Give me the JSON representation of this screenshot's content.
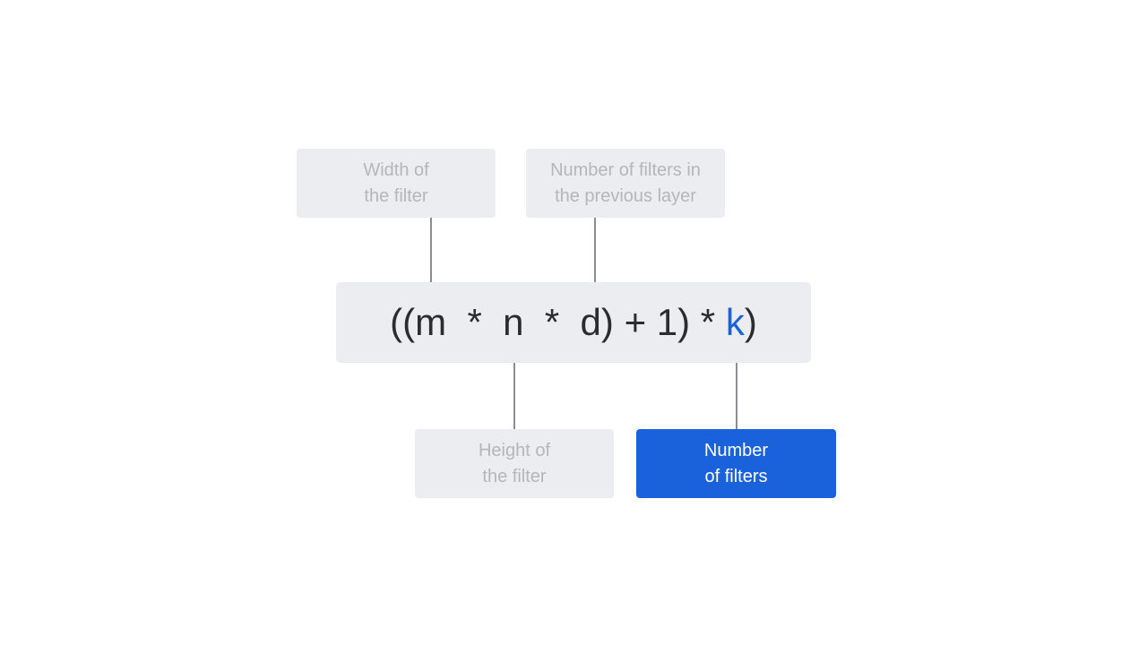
{
  "formula": {
    "parts": [
      "((m",
      "  *  ",
      "n",
      "  *  ",
      "d)",
      " + ",
      "1)",
      " * ",
      "k",
      ")"
    ],
    "highlight_color": "#1a62dc"
  },
  "labels": {
    "width": [
      "Width of",
      "the filter"
    ],
    "prev_filters": [
      "Number of filters in",
      "the previous layer"
    ],
    "height": [
      "Height of",
      "the filter"
    ],
    "num_filters": [
      "Number",
      "of filters"
    ]
  },
  "colors": {
    "box_bg": "#ebedf0",
    "active_bg": "#1a62dc",
    "text_dim": "#b4b6ba",
    "formula_text": "#2a2c30"
  }
}
